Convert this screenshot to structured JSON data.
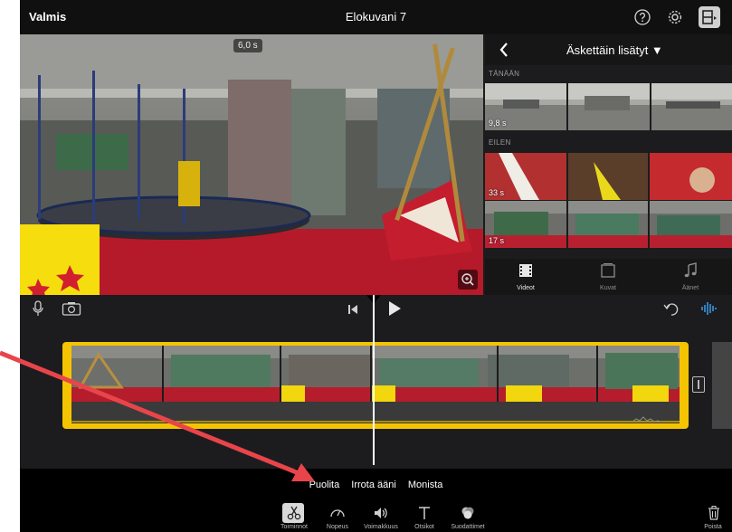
{
  "topbar": {
    "done_label": "Valmis",
    "title": "Elokuvani 7",
    "icons": [
      "help-icon",
      "gear-icon",
      "project-view-icon"
    ]
  },
  "viewer": {
    "duration": "6,0 s"
  },
  "browser": {
    "selector_label": "Äskettäin lisätyt ▼",
    "sections": [
      {
        "label": "TÄNÄÄN",
        "clips": [
          {
            "length": "9,8 s"
          }
        ]
      },
      {
        "label": "EILEN",
        "clips": [
          {
            "length": "33 s"
          },
          {
            "length": "17 s"
          }
        ]
      }
    ],
    "tabs": [
      {
        "label": "Videot",
        "icon": "video-icon",
        "active": true
      },
      {
        "label": "Kuvat",
        "icon": "photos-icon",
        "active": false
      },
      {
        "label": "Äänet",
        "icon": "music-icon",
        "active": false
      }
    ]
  },
  "timeline_toolbar": {
    "icons": [
      "microphone-icon",
      "camera-icon",
      "skip-to-start-icon",
      "play-icon",
      "undo-icon",
      "waveform-icon"
    ]
  },
  "actions": {
    "labels": [
      "Puolita",
      "Irrota ääni",
      "Monista"
    ],
    "tools": [
      {
        "label": "Toiminnot",
        "icon": "scissors-icon",
        "active": true
      },
      {
        "label": "Nopeus",
        "icon": "speed-icon",
        "active": false
      },
      {
        "label": "Voimakkuus",
        "icon": "volume-icon",
        "active": false
      },
      {
        "label": "Otsikot",
        "icon": "titles-icon",
        "active": false
      },
      {
        "label": "Suodattimet",
        "icon": "filters-icon",
        "active": false
      }
    ],
    "delete_label": "Poista"
  },
  "colors": {
    "accent_yellow": "#f5c400",
    "waveform_blue": "#3ea6ff",
    "annotation_red": "#e8454b",
    "background": "#1c1c1e"
  }
}
